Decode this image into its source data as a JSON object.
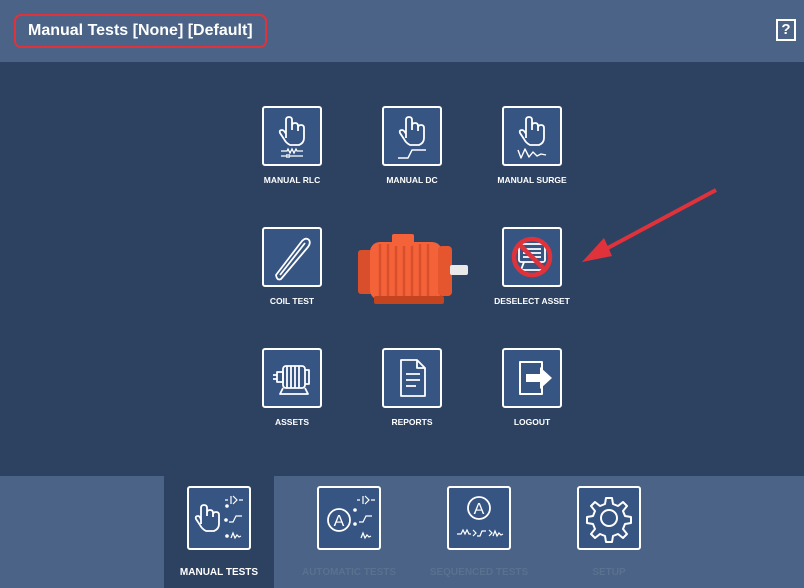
{
  "header": {
    "title": "Manual Tests  [None] [Default]",
    "help_label": "?"
  },
  "tiles": [
    {
      "label": "MANUAL RLC",
      "icon": "hand-rlc-icon"
    },
    {
      "label": "MANUAL DC",
      "icon": "hand-dc-icon"
    },
    {
      "label": "MANUAL SURGE",
      "icon": "hand-surge-icon"
    },
    {
      "label": "COIL TEST",
      "icon": "coil-icon"
    },
    {
      "label": "DESELECT ASSET",
      "icon": "deselect-asset-icon"
    },
    {
      "label": "ASSETS",
      "icon": "motor-outline-icon"
    },
    {
      "label": "REPORTS",
      "icon": "document-icon"
    },
    {
      "label": "LOGOUT",
      "icon": "logout-icon"
    }
  ],
  "bottom_tabs": [
    {
      "label": "MANUAL TESTS",
      "active": true
    },
    {
      "label": "AUTOMATIC TESTS",
      "active": false
    },
    {
      "label": "SEQUENCED TESTS",
      "active": false
    },
    {
      "label": "SETUP",
      "active": false
    }
  ],
  "colors": {
    "background": "#2d4261",
    "bar": "#4a6386",
    "highlight": "#e0323b",
    "motor": "#f4623a"
  }
}
